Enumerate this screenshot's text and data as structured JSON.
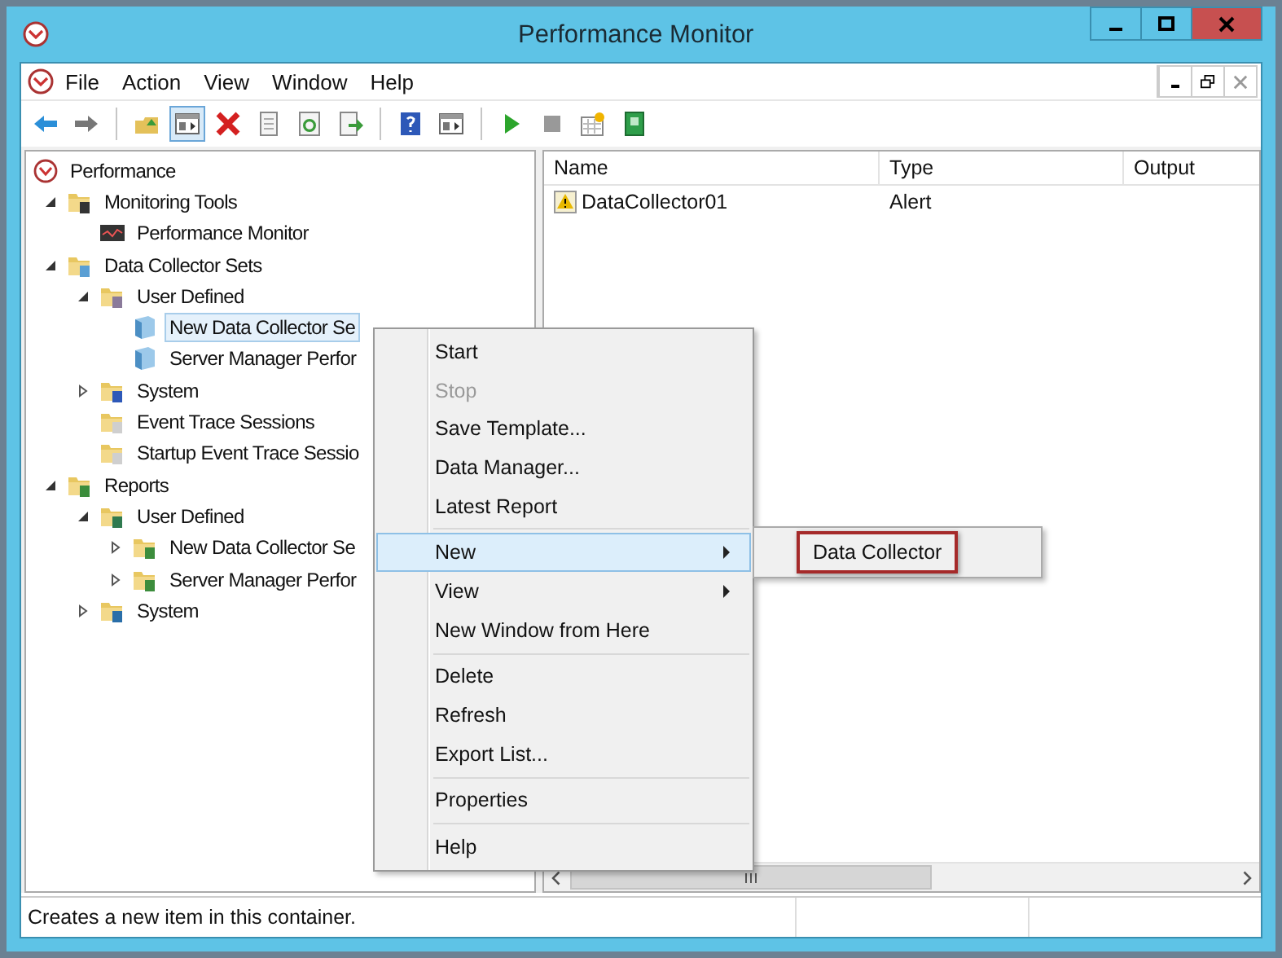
{
  "window": {
    "title": "Performance Monitor"
  },
  "menu_bar": [
    "File",
    "Action",
    "View",
    "Window",
    "Help"
  ],
  "toolbar": [
    {
      "kind": "back",
      "pressed": false
    },
    {
      "kind": "forward",
      "pressed": false
    },
    {
      "kind": "separator"
    },
    {
      "kind": "up",
      "pressed": false
    },
    {
      "kind": "tree",
      "pressed": true
    },
    {
      "kind": "delete",
      "pressed": false
    },
    {
      "kind": "properties",
      "pressed": false
    },
    {
      "kind": "refresh",
      "pressed": false
    },
    {
      "kind": "export",
      "pressed": false
    },
    {
      "kind": "separator"
    },
    {
      "kind": "help",
      "pressed": false
    },
    {
      "kind": "actionpane",
      "pressed": false
    },
    {
      "kind": "separator"
    },
    {
      "kind": "start",
      "pressed": false
    },
    {
      "kind": "stop",
      "pressed": false
    },
    {
      "kind": "new",
      "pressed": false
    },
    {
      "kind": "report",
      "pressed": false
    }
  ],
  "tree": [
    {
      "label": "Performance",
      "kind": "root",
      "selected": false,
      "children": [
        {
          "label": "Monitoring Tools",
          "kind": "tools",
          "expanded": true,
          "selected": false,
          "children": [
            {
              "label": "Performance Monitor",
              "kind": "monitor",
              "selected": false
            }
          ]
        },
        {
          "label": "Data Collector Sets",
          "kind": "sets",
          "expanded": true,
          "selected": false,
          "children": [
            {
              "label": "User Defined",
              "kind": "user",
              "expanded": true,
              "selected": false,
              "children": [
                {
                  "label": "New Data Collector Se",
                  "kind": "set",
                  "selected": true
                },
                {
                  "label": "Server Manager Perfor",
                  "kind": "set",
                  "selected": false
                }
              ]
            },
            {
              "label": "System",
              "kind": "system",
              "expanded": false,
              "selected": false
            },
            {
              "label": "Event Trace Sessions",
              "kind": "trace",
              "selected": false
            },
            {
              "label": "Startup Event Trace Sessio",
              "kind": "trace",
              "selected": false
            }
          ]
        },
        {
          "label": "Reports",
          "kind": "reports",
          "expanded": true,
          "selected": false,
          "children": [
            {
              "label": "User Defined",
              "kind": "reportuser",
              "expanded": true,
              "selected": false,
              "children": [
                {
                  "label": "New Data Collector Se",
                  "kind": "reports",
                  "expanded": false,
                  "selected": false
                },
                {
                  "label": "Server Manager Perfor",
                  "kind": "reports",
                  "expanded": false,
                  "selected": false
                }
              ]
            },
            {
              "label": "System",
              "kind": "reportsystem",
              "expanded": false,
              "selected": false
            }
          ]
        }
      ]
    }
  ],
  "table": {
    "columns": [
      "Name",
      "Type",
      "Output"
    ],
    "rows": [
      {
        "name": "DataCollector01",
        "type": "Alert"
      }
    ]
  },
  "context_menu": [
    {
      "kind": "item",
      "label": "Start",
      "disabled": false,
      "selected": false
    },
    {
      "kind": "item",
      "label": "Stop",
      "disabled": true,
      "selected": false
    },
    {
      "kind": "item",
      "label": "Save Template...",
      "disabled": false,
      "selected": false
    },
    {
      "kind": "item",
      "label": "Data Manager...",
      "disabled": false,
      "selected": false
    },
    {
      "kind": "item",
      "label": "Latest Report",
      "disabled": false,
      "selected": false
    },
    {
      "kind": "separator"
    },
    {
      "kind": "submenu",
      "label": "New",
      "disabled": false,
      "selected": true
    },
    {
      "kind": "submenu",
      "label": "View",
      "disabled": false,
      "selected": false
    },
    {
      "kind": "item",
      "label": "New Window from Here",
      "disabled": false,
      "selected": false
    },
    {
      "kind": "separator"
    },
    {
      "kind": "item",
      "label": "Delete",
      "disabled": false,
      "selected": false
    },
    {
      "kind": "item",
      "label": "Refresh",
      "disabled": false,
      "selected": false
    },
    {
      "kind": "item",
      "label": "Export List...",
      "disabled": false,
      "selected": false
    },
    {
      "kind": "separator"
    },
    {
      "kind": "item",
      "label": "Properties",
      "disabled": false,
      "selected": false
    },
    {
      "kind": "separator"
    },
    {
      "kind": "item",
      "label": "Help",
      "disabled": false,
      "selected": false
    }
  ],
  "submenu": [
    {
      "label": "Data Collector",
      "highlighted": true
    }
  ],
  "status_bar": "Creates a new item in this container."
}
